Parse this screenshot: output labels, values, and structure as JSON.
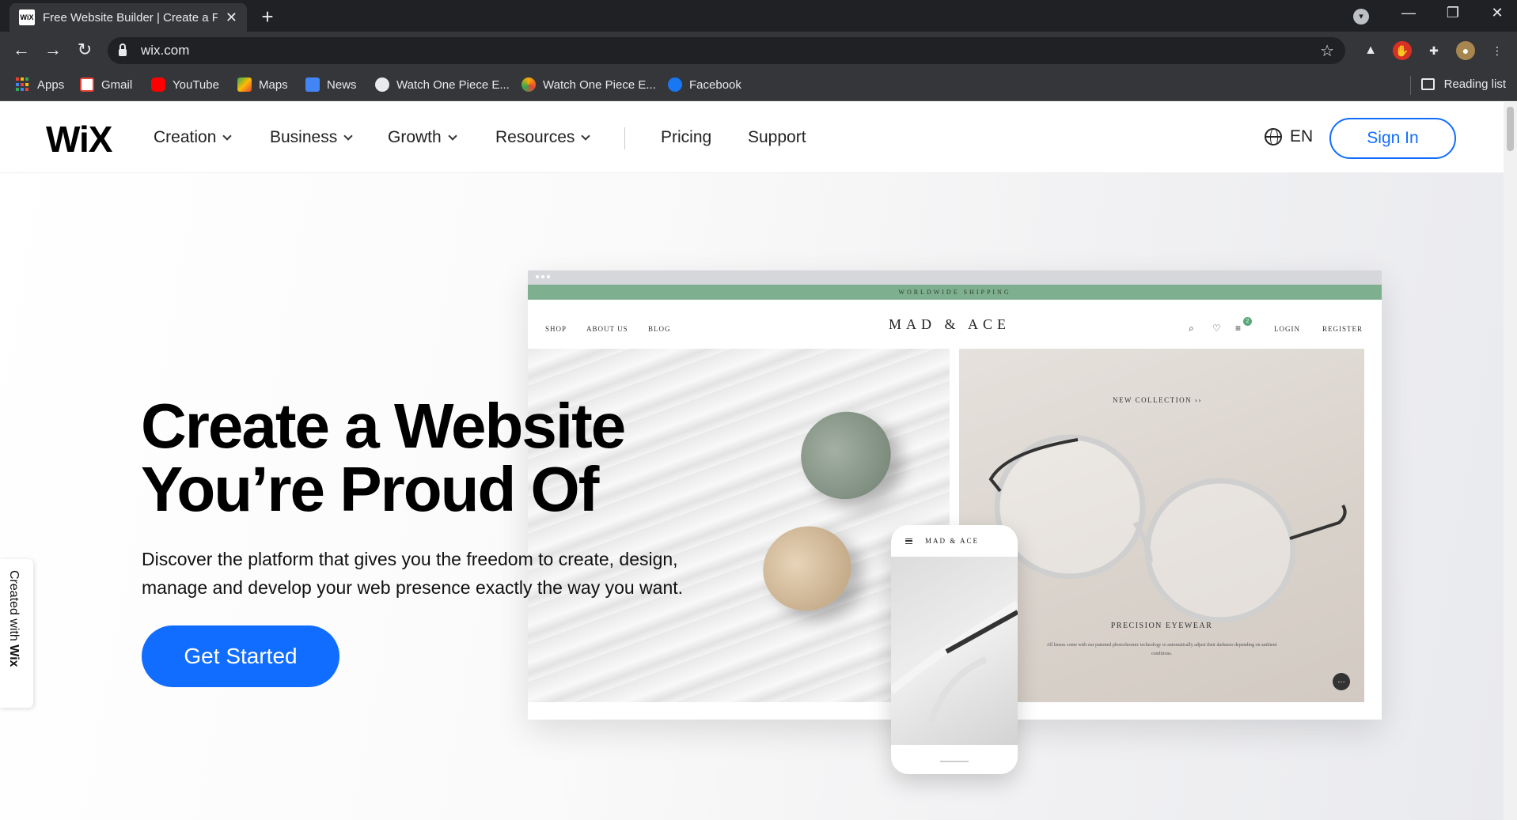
{
  "browser": {
    "tab_title": "Free Website Builder | Create a Free",
    "tab_favicon": "WiX",
    "new_tab": "+",
    "url": "wix.com",
    "bookmarks": [
      {
        "label": "Apps",
        "icon": "apps-grid-icon"
      },
      {
        "label": "Gmail",
        "icon": "gmail-icon",
        "color": "#ea4335"
      },
      {
        "label": "YouTube",
        "icon": "youtube-icon",
        "color": "#ff0000"
      },
      {
        "label": "Maps",
        "icon": "maps-icon",
        "color": "#34a853"
      },
      {
        "label": "News",
        "icon": "news-icon",
        "color": "#4285f4"
      },
      {
        "label": "Watch One Piece E...",
        "icon": "globe-icon",
        "color": "#e8eaed"
      },
      {
        "label": "Watch One Piece E...",
        "icon": "site-icon",
        "color": "#f9ab00"
      },
      {
        "label": "Facebook",
        "icon": "facebook-icon",
        "color": "#1877f2"
      }
    ],
    "reading_list": "Reading list"
  },
  "site": {
    "logo": "WiX",
    "menu": [
      {
        "label": "Creation",
        "has_dropdown": true
      },
      {
        "label": "Business",
        "has_dropdown": true
      },
      {
        "label": "Growth",
        "has_dropdown": true
      },
      {
        "label": "Resources",
        "has_dropdown": true
      },
      {
        "label": "Pricing",
        "has_dropdown": false
      },
      {
        "label": "Support",
        "has_dropdown": false
      }
    ],
    "language": "EN",
    "sign_in": "Sign In",
    "accent_color": "#116dff"
  },
  "hero": {
    "title_line1": "Create a Website",
    "title_line2": "You’re Proud Of",
    "subtitle_line1": "Discover the platform that gives you the freedom to create, design,",
    "subtitle_line2": "manage and develop your web presence exactly the way you want.",
    "cta": "Get Started"
  },
  "badge": {
    "created_with": "Created with ",
    "brand": "Wix"
  },
  "mockup": {
    "shipping": "WORLDWIDE SHIPPING",
    "nav": [
      "SHOP",
      "ABOUT US",
      "BLOG"
    ],
    "brand": "MAD & ACE",
    "cart_count": "2",
    "login": "LOGIN",
    "register": "REGISTER",
    "new_collection": "NEW COLLECTION  ››",
    "product_title": "PRECISION EYEWEAR",
    "product_desc": "All lenses come with our patented photochromic technology to automatically adjust their darkness depending on ambient conditions.",
    "phone_brand": "MAD & ACE"
  }
}
